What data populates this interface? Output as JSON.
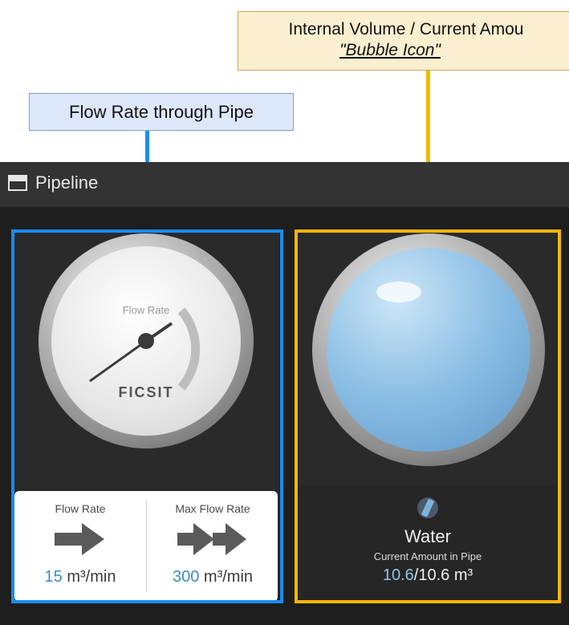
{
  "annotations": {
    "flow_callout": "Flow Rate through Pipe",
    "volume_callout_line1": "Internal Volume / Current Amou",
    "volume_callout_line2": "\"Bubble Icon\"",
    "flow_color": "#1a8cf0",
    "volume_color": "#f5b800"
  },
  "window": {
    "title": "Pipeline",
    "icon": "window-icon"
  },
  "gauge": {
    "label": "Flow Rate",
    "brand": "FICSIT",
    "icon": "flow-gauge-icon"
  },
  "stats": {
    "flow_rate": {
      "label": "Flow Rate",
      "value": "15",
      "unit": "m³/min",
      "icon": "arrow-right-icon"
    },
    "max_flow_rate": {
      "label": "Max Flow Rate",
      "value": "300",
      "unit": "m³/min",
      "icon": "double-arrow-right-icon"
    }
  },
  "fluid": {
    "name": "Water",
    "label": "Current Amount in Pipe",
    "current": "10.6",
    "capacity": "/10.6 m³",
    "icon": "water-icon",
    "bubble_color": "#8fc1e6"
  }
}
